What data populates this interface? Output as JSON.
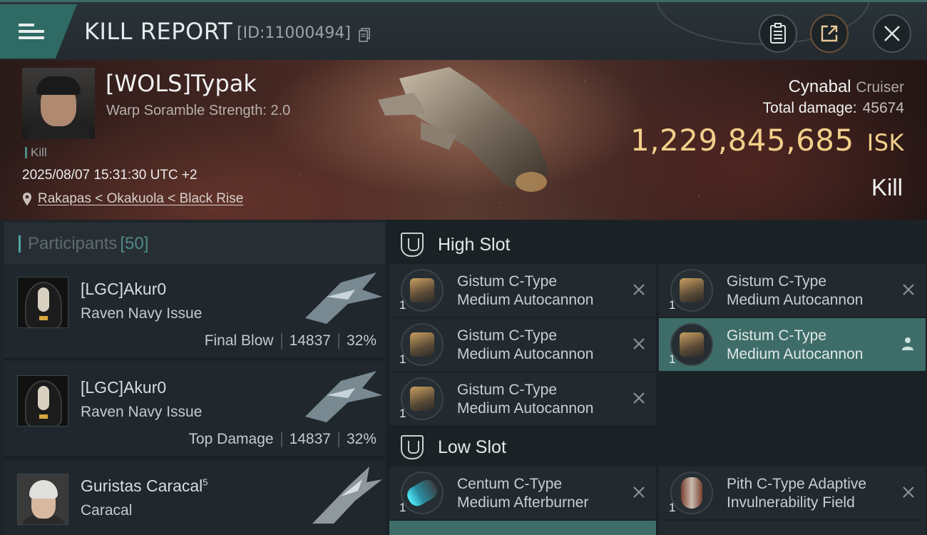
{
  "header": {
    "title": "KILL REPORT",
    "report_id": "[ID:11000494]",
    "icons": {
      "menu": "hamburger-icon",
      "copy": "copy-icon",
      "clipboard": "clipboard-icon",
      "share": "share-icon",
      "close": "close-icon"
    }
  },
  "victim": {
    "name": "[WOLS]Typak",
    "subtitle": "Warp Soramble Strength: 2.0",
    "tag": "Kill",
    "time": "2025/08/07 15:31:30 UTC +2",
    "location": "Rakapas < Okakuola < Black Rise",
    "ship": "Cynabal",
    "ship_class": "Cruiser",
    "total_damage_label": "Total damage:",
    "total_damage": "45674",
    "isk_value": "1,229,845,685",
    "isk_unit": "ISK",
    "result": "Kill"
  },
  "participants": {
    "label": "Participants",
    "count": "[50]",
    "rows": [
      {
        "name": "[LGC]Akur0",
        "sup": "",
        "ship": "Raven Navy Issue",
        "role": "Final Blow",
        "damage": "14837",
        "percent": "32%"
      },
      {
        "name": "[LGC]Akur0",
        "sup": "",
        "ship": "Raven Navy Issue",
        "role": "Top Damage",
        "damage": "14837",
        "percent": "32%"
      },
      {
        "name": "Guristas Caracal",
        "sup": "5",
        "ship": "Caracal",
        "role": "",
        "damage": "",
        "percent": ""
      }
    ]
  },
  "slots": {
    "high_label": "High Slot",
    "low_label": "Low Slot",
    "high": [
      {
        "qty": "1",
        "line1": "Gistum C-Type",
        "line2": "Medium Autocannon",
        "status": "destroyed"
      },
      {
        "qty": "1",
        "line1": "Gistum C-Type",
        "line2": "Medium Autocannon",
        "status": "destroyed"
      },
      {
        "qty": "1",
        "line1": "Gistum C-Type",
        "line2": "Medium Autocannon",
        "status": "destroyed"
      },
      {
        "qty": "1",
        "line1": "Gistum C-Type",
        "line2": "Medium Autocannon",
        "status": "dropped"
      },
      {
        "qty": "1",
        "line1": "Gistum C-Type",
        "line2": "Medium Autocannon",
        "status": "destroyed"
      }
    ],
    "low": [
      {
        "qty": "1",
        "line1": "Centum C-Type",
        "line2": "Medium Afterburner",
        "status": "destroyed"
      },
      {
        "qty": "1",
        "line1": "Pith C-Type Adaptive",
        "line2": "Invulnerability Field",
        "status": "destroyed"
      }
    ]
  },
  "colors": {
    "accent": "#3e6d69",
    "isk": "#f2cf8a",
    "teal": "#4f8c88"
  }
}
